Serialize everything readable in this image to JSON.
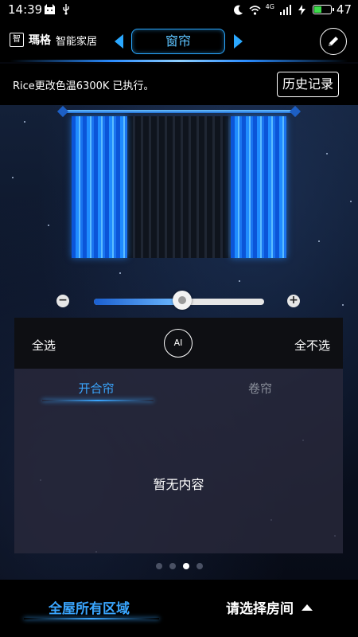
{
  "status_bar": {
    "time": "14:39",
    "network_label": "4G",
    "battery_percent": "47",
    "battery_level": 0.47,
    "icons": [
      "cat-icon",
      "usb-icon",
      "moon-icon",
      "wifi-icon",
      "signal-icon",
      "charging-icon",
      "battery-icon"
    ]
  },
  "header": {
    "brand_logo_char": "智",
    "brand_name": "瑪格",
    "brand_tagline": "智能家居",
    "device_tab": "窗帘",
    "accent_color": "#2aa8ff"
  },
  "notice": {
    "message": "Rice更改色温6300K 已执行。",
    "history_label": "历史记录"
  },
  "curtain": {
    "open_level": 0.5
  },
  "controls": {
    "minus": "−",
    "plus": "+",
    "ai_label": "AI",
    "select_all": "全选",
    "deselect_all": "全不选"
  },
  "tabs": [
    {
      "label": "开合帘",
      "active": true
    },
    {
      "label": "卷帘",
      "active": false
    }
  ],
  "list": {
    "empty_text": "暂无内容"
  },
  "pagination": {
    "total": 4,
    "current": 3
  },
  "bottom_bar": {
    "area_label": "全屋所有区域",
    "room_label": "请选择房间"
  }
}
